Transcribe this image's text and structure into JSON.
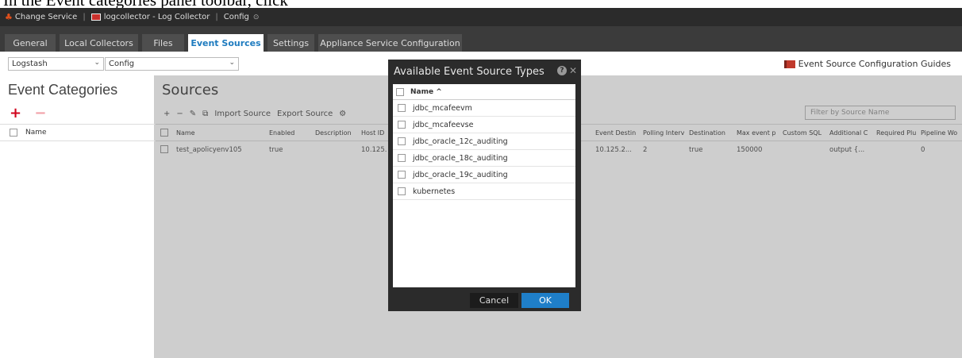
{
  "caption": "In the Event categories panel toolbar, click",
  "topbar": {
    "change_service": "Change Service",
    "collector": "logcollector - Log Collector",
    "config": "Config"
  },
  "tabs": [
    "General",
    "Local Collectors",
    "Files",
    "Event Sources",
    "Settings",
    "Appliance Service Configuration"
  ],
  "active_tab": "Event Sources",
  "subbar": {
    "select1": "Logstash",
    "select2": "Config",
    "guides": "Event Source Configuration Guides"
  },
  "left": {
    "title": "Event Categories",
    "plus": "+",
    "minus": "−",
    "col_name": "Name"
  },
  "sources": {
    "title": "Sources",
    "toolbar": [
      "+",
      "−",
      "✎",
      "⧉",
      "Import Source",
      "Export Source",
      "⚙"
    ],
    "filter_placeholder": "Filter by Source Name",
    "columns": [
      "Name",
      "Enabled",
      "Description",
      "Host ID",
      "Event Destin",
      "Polling Interv",
      "Destination",
      "Max event p",
      "Custom SQL",
      "Additional C",
      "Required Plu",
      "Pipeline Wo"
    ],
    "row": {
      "name": "test_apolicyenv105",
      "enabled": "true",
      "host": "10.125.",
      "event_dest": "10.125.2...",
      "polling": "2",
      "destination": "true",
      "max_event": "150000",
      "additional": "output {...",
      "pipeline": "0"
    }
  },
  "dialog": {
    "title": "Available Event Source Types",
    "col_name": "Name ^",
    "items": [
      "jdbc_mcafeevm",
      "jdbc_mcafeevse",
      "jdbc_oracle_12c_auditing",
      "jdbc_oracle_18c_auditing",
      "jdbc_oracle_19c_auditing",
      "kubernetes"
    ],
    "cancel": "Cancel",
    "ok": "OK"
  },
  "colors": {
    "accent": "#1f7fc9",
    "add": "#d0021b",
    "dark": "#2b2b2b"
  }
}
